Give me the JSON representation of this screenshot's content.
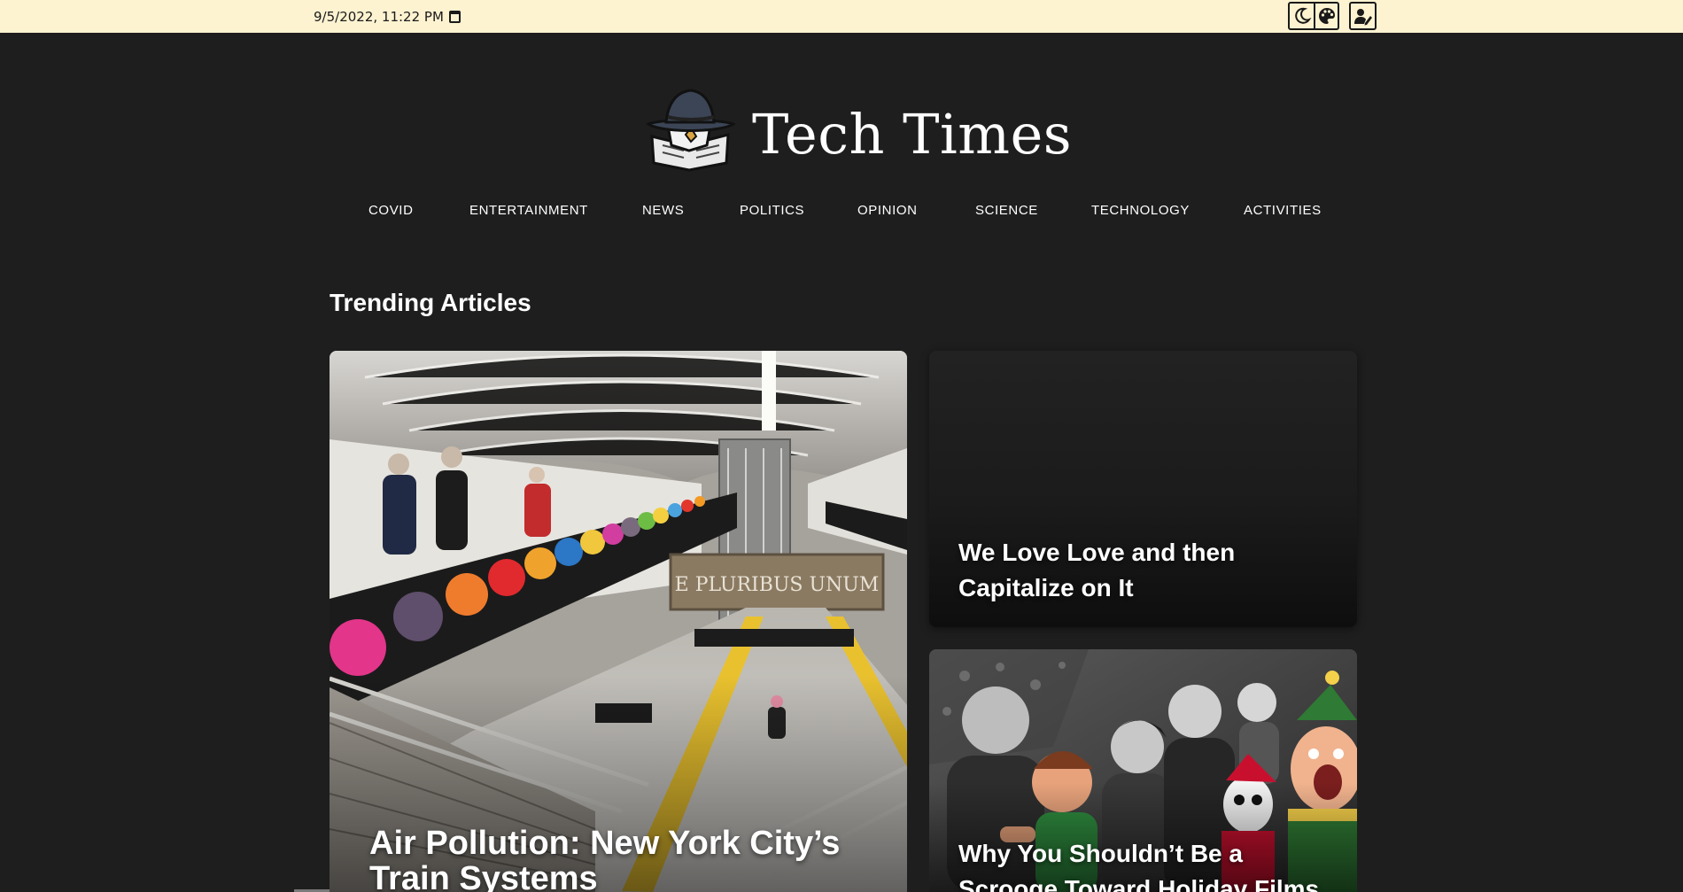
{
  "topbar": {
    "datetime": "9/5/2022, 11:22 PM",
    "background": "#fdf3d1",
    "tools": [
      {
        "icon": "moon-icon"
      },
      {
        "icon": "palette-icon"
      },
      {
        "icon": "edit-profile-icon"
      }
    ]
  },
  "header": {
    "title": "Tech Times",
    "logo": "detective-newspaper-logo"
  },
  "nav": {
    "items": [
      {
        "label": "COVID"
      },
      {
        "label": "ENTERTAINMENT"
      },
      {
        "label": "NEWS"
      },
      {
        "label": "POLITICS"
      },
      {
        "label": "OPINION"
      },
      {
        "label": "SCIENCE"
      },
      {
        "label": "TECHNOLOGY"
      },
      {
        "label": "ACTIVITIES"
      }
    ]
  },
  "main": {
    "section_title": "Trending Articles",
    "articles": [
      {
        "title": "Air Pollution: New York City’s Train Systems",
        "image": "subway-station-photo"
      },
      {
        "title": "We Love Love and then Capitalize on It",
        "image": ""
      },
      {
        "title": "Why You Shouldn’t Be a Scrooge Toward Holiday Films",
        "image": "holiday-movie-collage"
      }
    ]
  },
  "colors": {
    "page_background": "#1e1e1e",
    "text": "#ffffff",
    "topbar_text": "#1a1a1a"
  }
}
